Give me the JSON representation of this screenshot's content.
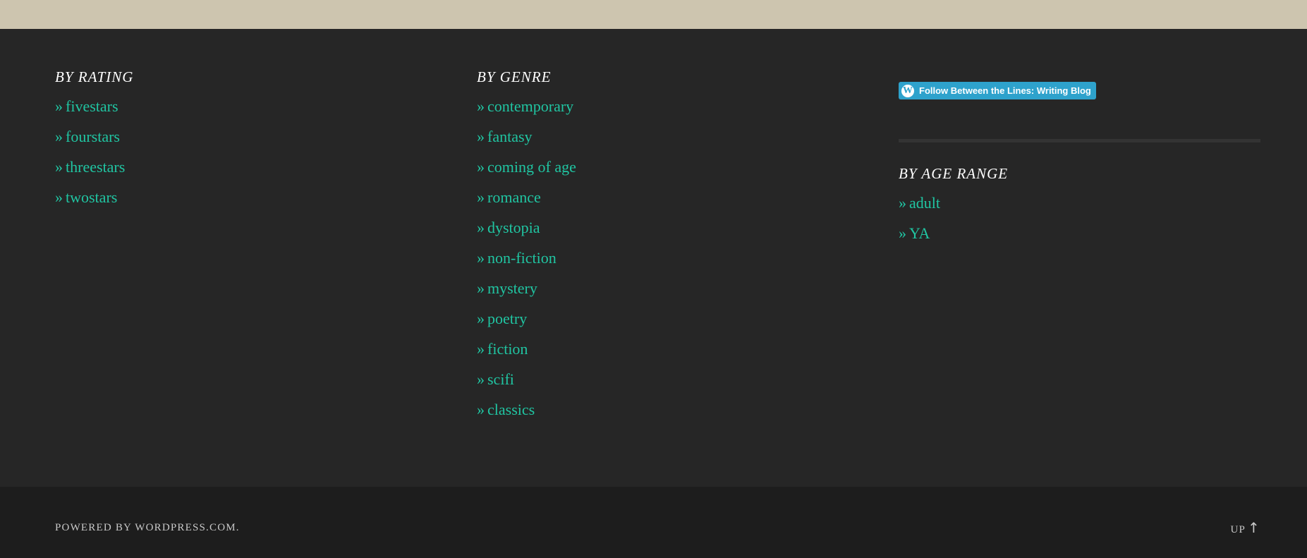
{
  "rating_widget": {
    "title": "BY RATING",
    "prefix": "»",
    "items": [
      "fivestars",
      "fourstars",
      "threestars",
      "twostars"
    ]
  },
  "genre_widget": {
    "title": "BY GENRE",
    "prefix": "»",
    "items": [
      "contemporary",
      "fantasy",
      "coming of age",
      "romance",
      "dystopia",
      "non-fiction",
      "mystery",
      "poetry",
      "fiction",
      "scifi",
      "classics"
    ]
  },
  "follow": {
    "label": "Follow Between the Lines: Writing Blog",
    "icon": "wordpress-icon",
    "icon_glyph": "W",
    "color": "#2ea2cc"
  },
  "age_widget": {
    "title": "BY AGE RANGE",
    "prefix": "»",
    "items": [
      "adult",
      "YA"
    ]
  },
  "footer": {
    "powered_by": "POWERED BY ",
    "powered_link": "WORDPRESS.COM",
    "powered_suffix": ".",
    "up_label": "UP",
    "up_arrow": "↑"
  },
  "colors": {
    "top_band": "#cdc5af",
    "widget_background": "#262626",
    "footer_background": "#1d1d1d",
    "link": "#20c5a2",
    "title": "#ffffff",
    "footer_text": "#c9c9c9"
  }
}
